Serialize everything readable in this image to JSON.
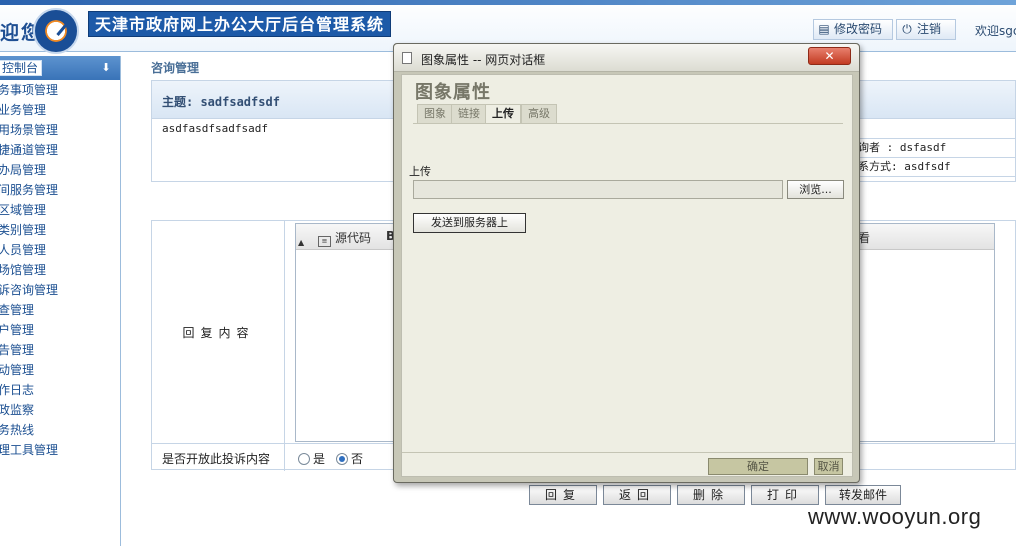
{
  "header": {
    "welcome_left": "迎您",
    "system_title": "天津市政府网上办公大厅后台管理系统",
    "change_password": "修改密码",
    "logout": "注销",
    "welcome_text": "欢迎sgc"
  },
  "sidebar": {
    "title": "控制台",
    "items": [
      {
        "label": "务事项管理"
      },
      {
        "label": "业务管理"
      },
      {
        "label": "用场景管理"
      },
      {
        "label": "捷通道管理"
      },
      {
        "label": "办局管理"
      },
      {
        "label": "间服务管理"
      },
      {
        "label": "区域管理"
      },
      {
        "label": "类别管理"
      },
      {
        "label": "人员管理"
      },
      {
        "label": "场馆管理"
      },
      {
        "label": "诉咨询管理"
      },
      {
        "label": "查管理"
      },
      {
        "label": "户管理"
      },
      {
        "label": "告管理"
      },
      {
        "label": "动管理"
      },
      {
        "label": "作日志"
      },
      {
        "label": "政监察"
      },
      {
        "label": "务热线"
      },
      {
        "label": "理工具管理"
      }
    ]
  },
  "main": {
    "title": "咨询管理",
    "topic_label": "主题: sadfsadfsdf",
    "topic_text": "asdfasdfsadfsadf",
    "asker": "询者 : dsfasdf",
    "contact": "系方式: asdfsdf",
    "reply_label": "回复内容",
    "editor": {
      "source_label": "源代码",
      "sep_glyph": "B",
      "right_glyph": "看"
    },
    "open_question": "是否开放此投诉内容",
    "radio_yes": "是",
    "radio_no": "否",
    "selected": "否",
    "buttons": {
      "reply": "回复",
      "back": "返回",
      "delete": "删除",
      "print": "打印",
      "forward": "转发邮件"
    }
  },
  "dialog": {
    "title": "图象属性 -- 网页对话框",
    "close": "✕",
    "heading": "图象属性",
    "tabs": [
      {
        "label": "图象"
      },
      {
        "label": "链接"
      },
      {
        "label": "上传"
      },
      {
        "label": "高级"
      }
    ],
    "active_tab": "上传",
    "upload_label": "上传",
    "browse": "浏览...",
    "send": "发送到服务器上",
    "ok": "确定",
    "cancel": "取消"
  },
  "watermark": "www.wooyun.org",
  "colors": {
    "header_blue": "#1d5aa8",
    "sidebar_blue": "#3973b8",
    "dialog_bg": "#eeeee3",
    "close_red": "#c23b22"
  }
}
